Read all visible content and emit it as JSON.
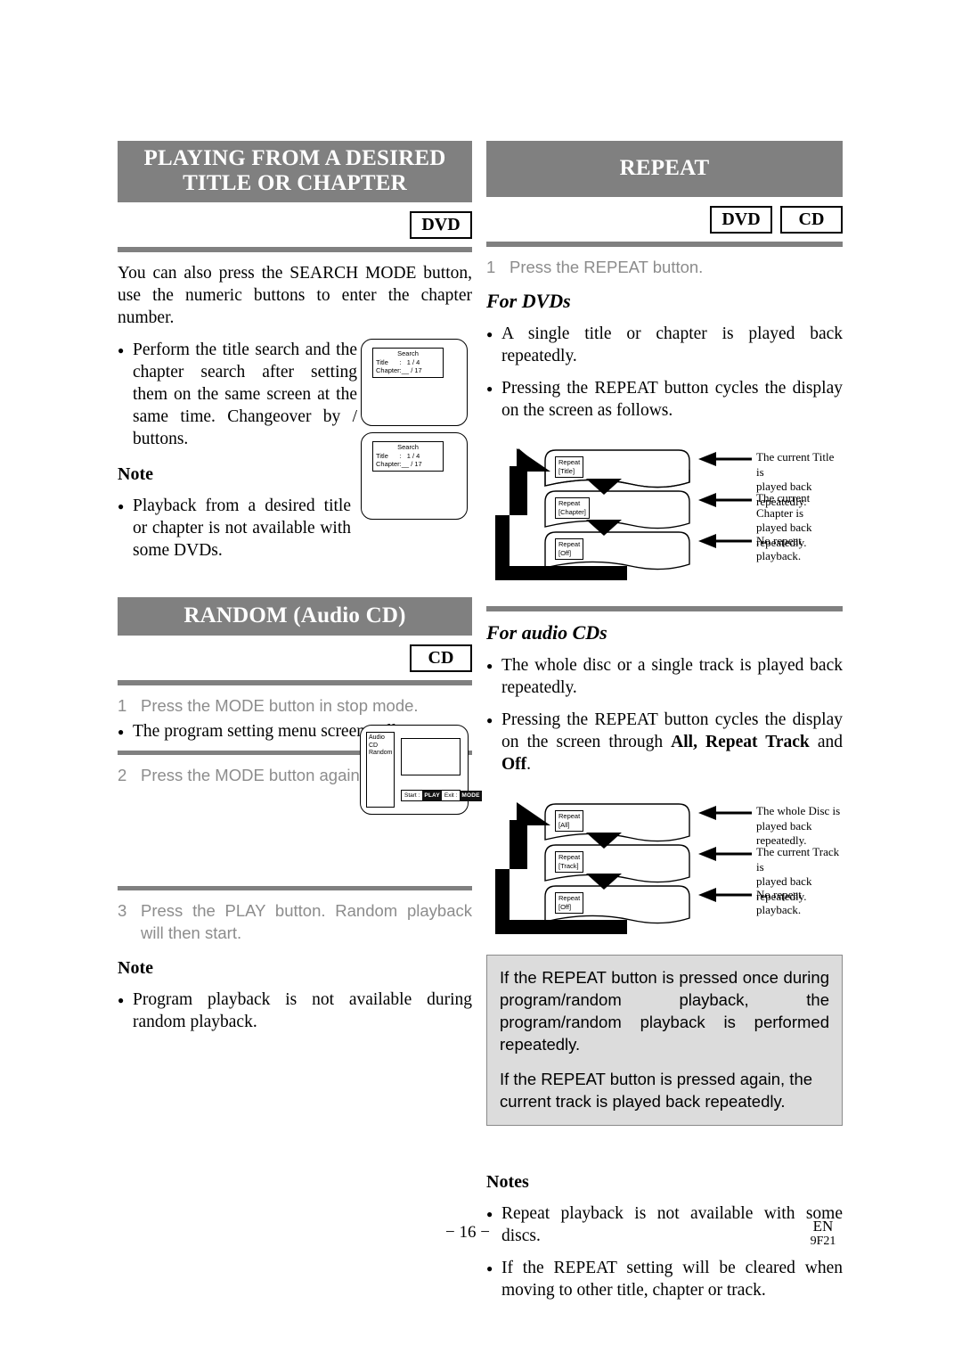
{
  "left_column": {
    "section1": {
      "title_line1": "PLAYING FROM A DESIRED",
      "title_line2": "TITLE OR CHAPTER",
      "badges": [
        "DVD"
      ],
      "intro": "You can also press the SEARCH MODE button, use the numeric buttons to enter the chapter number.",
      "bullet1": "Perform the title search and the chapter search after setting them on the same screen at the same time. Changeover by    /    buttons.",
      "note_heading": "Note",
      "note_bullet": "Playback from a desired title or chapter is not available with some DVDs.",
      "screen1": {
        "osd_title": "Search",
        "osd_line1": "Title      :   1 / 4",
        "osd_line2": "Chapter:__ / 17"
      },
      "screen2": {
        "osd_title": "Search",
        "osd_line1": "Title      :   1 / 4",
        "osd_line2": "Chapter:__ / 17"
      }
    },
    "section2": {
      "title": "RANDOM (Audio CD)",
      "badges": [
        "CD"
      ],
      "steps": [
        {
          "num": "1",
          "text": "Press the MODE button in stop mode."
        },
        {
          "num": "2",
          "text": "Press the MODE button again."
        },
        {
          "num": "3",
          "text": "Press the PLAY button. Random playback will then start."
        }
      ],
      "bullet_after_step1": "The program setting menu screen will appear.",
      "note_heading": "Note",
      "note_bullet": "Program playback is not available during random playback.",
      "random_screen": {
        "side_line1": "Audio CD",
        "side_line2": "Random",
        "bar_start_label": "Start  :",
        "bar_start_key": "PLAY",
        "bar_exit_label": "Exit  :",
        "bar_exit_key": "MODE"
      }
    }
  },
  "right_column": {
    "section": {
      "title": "REPEAT",
      "badges": [
        "DVD",
        "CD"
      ],
      "step1": {
        "num": "1",
        "text": "Press the REPEAT button."
      },
      "for_dvds": {
        "heading": "For DVDs",
        "bullet1": "A single title or chapter is played back repeatedly.",
        "bullet2": "Pressing the REPEAT button cycles the display on the screen as follows.",
        "cycle": [
          {
            "osd_line1": "Repeat",
            "osd_line2": "[Title]",
            "label_line1": "The current Title is",
            "label_line2": "played back repeatedly."
          },
          {
            "osd_line1": "Repeat",
            "osd_line2": "[Chapter]",
            "label_line1": "The current Chapter is",
            "label_line2": "played back repeatedly."
          },
          {
            "osd_line1": "Repeat",
            "osd_line2": "[Off]",
            "label_line1": "No repeat playback.",
            "label_line2": ""
          }
        ]
      },
      "for_cds": {
        "heading": "For audio CDs",
        "bullet1": "The whole disc or a single track is played back repeatedly.",
        "bullet2_part1": "Pressing the REPEAT button cycles the display on the screen through ",
        "bullet2_bold1": "All, Repeat Track",
        "bullet2_part2": " and ",
        "bullet2_bold2": "Off",
        "bullet2_part3": ".",
        "cycle": [
          {
            "osd_line1": "Repeat",
            "osd_line2": "[All]",
            "label_line1": "The whole Disc is",
            "label_line2": "played back repeatedly."
          },
          {
            "osd_line1": "Repeat",
            "osd_line2": "[Track]",
            "label_line1": "The current Track is",
            "label_line2": "played back repeatedly."
          },
          {
            "osd_line1": "Repeat",
            "osd_line2": "[Off]",
            "label_line1": "No repeat playback.",
            "label_line2": ""
          }
        ]
      },
      "callout": {
        "paragraph1": "If the REPEAT button is pressed once during program/random playback, the program/random playback is performed repeatedly.",
        "paragraph2": "If the REPEAT button is pressed again, the current track is played back repeatedly."
      },
      "notes_heading": "Notes",
      "notes": [
        "Repeat playback is not available with some discs.",
        "If the REPEAT setting will be cleared when moving to other title, chapter or track."
      ]
    }
  },
  "footer": {
    "page_number": "− 16 −",
    "language": "EN",
    "code": "9F21"
  },
  "colors": {
    "banner_bg": "#808080",
    "rule": "#808080",
    "step_text": "#8c8c8c",
    "callout_bg": "#dcdcdc"
  }
}
